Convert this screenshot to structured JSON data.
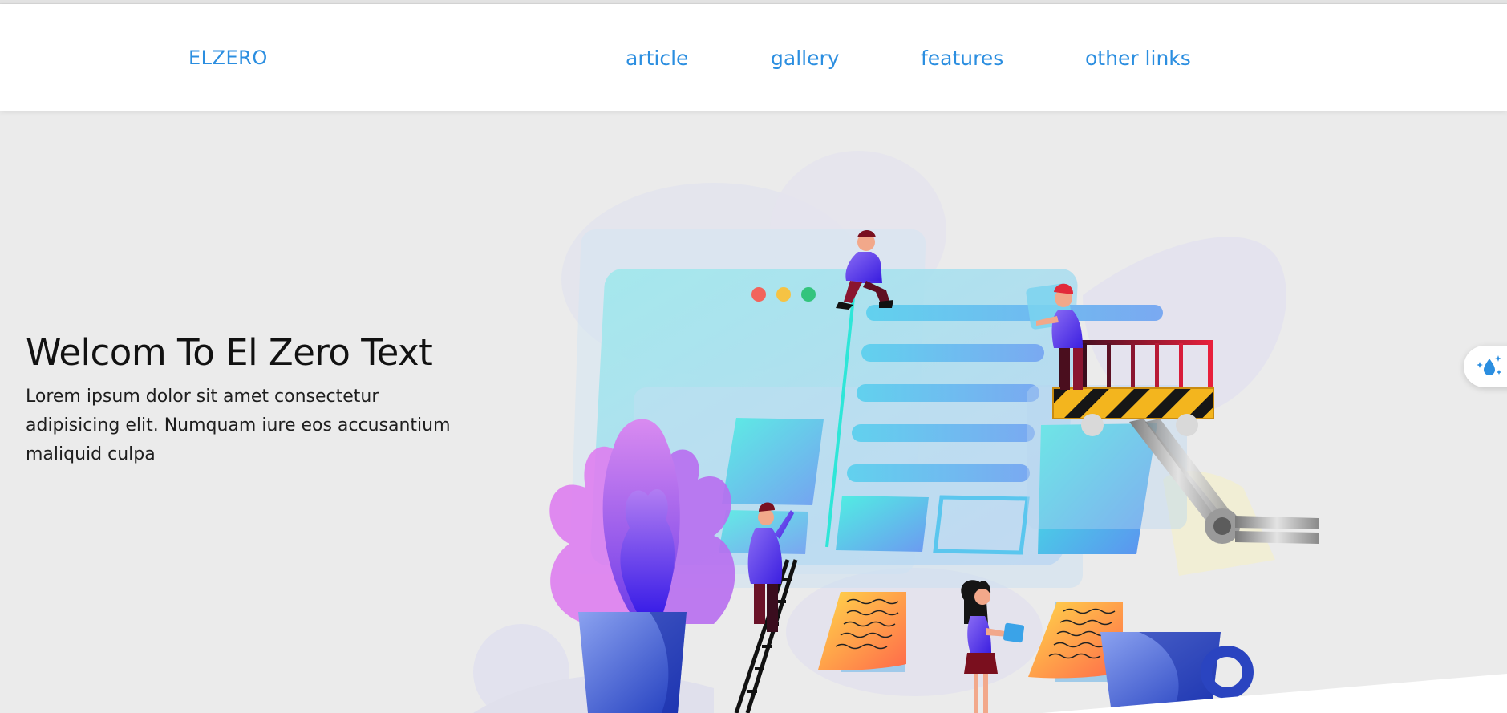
{
  "header": {
    "logo": "ELZERO",
    "nav": [
      "article",
      "gallery",
      "features",
      "other links"
    ]
  },
  "hero": {
    "title": "Welcom To El Zero Text",
    "description": "Lorem ipsum dolor sit amet consectetur adipisicing elit. Numquam iure eos accusantium maliquid culpa"
  },
  "colors": {
    "accent": "#2b8ee0",
    "background": "#ebebeb",
    "header_bg": "#ffffff"
  },
  "icons": {
    "side_widget": "water-drop-sparkle-icon"
  }
}
